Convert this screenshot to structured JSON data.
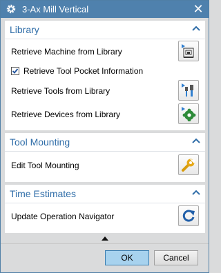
{
  "window": {
    "title": "3-Ax Mill Vertical",
    "close_glyph": "✕"
  },
  "sections": {
    "library": {
      "title": "Library",
      "retrieve_machine": {
        "label": "Retrieve Machine from Library",
        "icon": "machine-library-icon"
      },
      "retrieve_pocket": {
        "label": "Retrieve Tool Pocket Information",
        "checked": true
      },
      "retrieve_tools": {
        "label": "Retrieve Tools from Library",
        "icon": "tool-library-icon"
      },
      "retrieve_devices": {
        "label": "Retrieve Devices from Library",
        "icon": "device-library-icon"
      }
    },
    "tool_mounting": {
      "title": "Tool Mounting",
      "edit": {
        "label": "Edit Tool Mounting",
        "icon": "wrench-icon"
      }
    },
    "time_estimates": {
      "title": "Time Estimates",
      "update": {
        "label": "Update Operation Navigator",
        "icon": "refresh-icon"
      }
    }
  },
  "footer": {
    "ok_label": "OK",
    "cancel_label": "Cancel"
  },
  "colors": {
    "titlebar": "#4f81ad",
    "section_title": "#2f6da8",
    "ok_button": "#a7d2ee",
    "background": "#dadbdc"
  }
}
